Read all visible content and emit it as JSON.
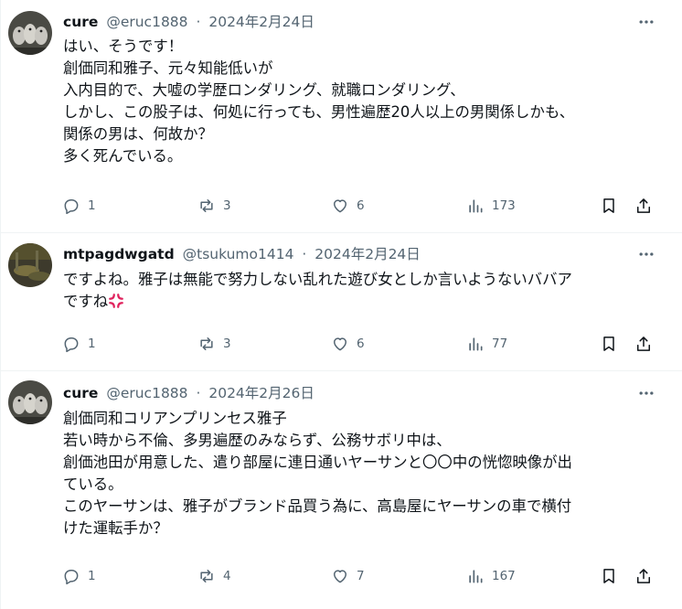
{
  "tweets": [
    {
      "name": "cure",
      "handle": "@eruc1888",
      "sep": "·",
      "date": "2024年2月24日",
      "lines": [
        "はい、そうです！",
        "創価同和雅子、元々知能低いが",
        "入内目的で、大嘘の学歴ロンダリング、就職ロンダリング、",
        "しかし、この股子は、何処に行っても、男性遍歴20人以上の男関係しかも、",
        "関係の男は、何故か？",
        "多く死んでいる。"
      ],
      "replies": "1",
      "reposts": "3",
      "likes": "6",
      "views": "173"
    },
    {
      "name": "mtpagdwgatd",
      "handle": "@tsukumo1414",
      "sep": "·",
      "date": "2024年2月24日",
      "lines": [
        "ですよね。雅子は無能で努力しない乱れた遊び女としか言いようないババア",
        "ですね"
      ],
      "emoji": "anger-symbol",
      "replies": "1",
      "reposts": "3",
      "likes": "6",
      "views": "77"
    },
    {
      "name": "cure",
      "handle": "@eruc1888",
      "sep": "·",
      "date": "2024年2月26日",
      "lines": [
        "創価同和コリアンプリンセス雅子",
        "若い時から不倫、多男遍歴のみならず、公務サボリ中は、",
        "創価池田が用意した、遣り部屋に連日通いヤーサンと〇〇中の恍惚映像が出",
        "ている。",
        "このヤーサンは、雅子がブランド品買う為に、高島屋にヤーサンの車で横付",
        "けた運転手か？"
      ],
      "replies": "1",
      "reposts": "4",
      "likes": "7",
      "views": "167"
    }
  ],
  "colors": {
    "text": "#0f1419",
    "meta": "#536471",
    "divider": "#eff3f4",
    "anger": "#e0245e"
  },
  "icons": [
    "reply-icon",
    "repost-icon",
    "like-icon",
    "views-icon",
    "bookmark-icon",
    "share-icon",
    "more-icon"
  ]
}
